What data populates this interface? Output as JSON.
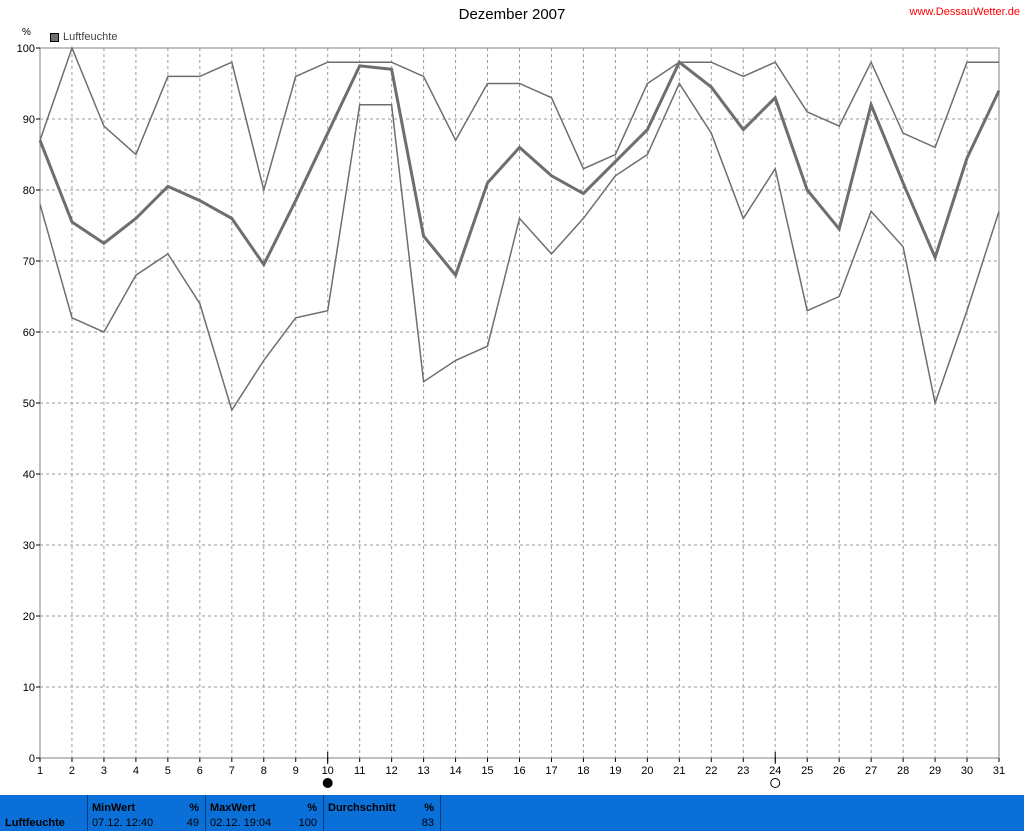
{
  "header": {
    "title": "Dezember 2007",
    "site": "www.DessauWetter.de"
  },
  "legend": {
    "label": "Luftfeuchte",
    "color": "#6e6e6e"
  },
  "chart_data": {
    "type": "line",
    "title": "Dezember 2007",
    "ylabel": "%",
    "xlabel": "",
    "ylim": [
      0,
      100
    ],
    "yticks": [
      0,
      10,
      20,
      30,
      40,
      50,
      60,
      70,
      80,
      90,
      100
    ],
    "xlim": [
      1,
      31
    ],
    "x": [
      1,
      2,
      3,
      4,
      5,
      6,
      7,
      8,
      9,
      10,
      11,
      12,
      13,
      14,
      15,
      16,
      17,
      18,
      19,
      20,
      21,
      22,
      23,
      24,
      25,
      26,
      27,
      28,
      29,
      30,
      31
    ],
    "series": [
      {
        "name": "max",
        "values": [
          87,
          100,
          89,
          85,
          96,
          96,
          98,
          80,
          96,
          98,
          98,
          98,
          96,
          87,
          95,
          95,
          93,
          83,
          85,
          95,
          98,
          98,
          96,
          98,
          91,
          89,
          98,
          88,
          86,
          98,
          98
        ]
      },
      {
        "name": "avg",
        "values": [
          87,
          75.5,
          72.5,
          76,
          80.5,
          78.5,
          76,
          69.5,
          78.5,
          88,
          97.5,
          97,
          73.5,
          68,
          81,
          86,
          82,
          79.5,
          84,
          88.5,
          98,
          94.5,
          88.5,
          93,
          80,
          74.5,
          92,
          81,
          70.5,
          84.5,
          94
        ]
      },
      {
        "name": "min",
        "values": [
          78,
          62,
          60,
          68,
          71,
          64,
          49,
          56,
          62,
          63,
          92,
          92,
          53,
          56,
          58,
          76,
          71,
          76,
          82,
          85,
          95,
          88,
          76,
          83,
          63,
          65,
          77,
          72,
          50,
          63,
          77
        ]
      }
    ],
    "markers": [
      {
        "x": 10,
        "kind": "filled"
      },
      {
        "x": 24,
        "kind": "open"
      }
    ],
    "grid": true,
    "legend_position": "top-left"
  },
  "footer": {
    "row_label": "Luftfeuchte",
    "min": {
      "header": "MinWert",
      "unit": "%",
      "date": "07.12.  12:40",
      "value": "49"
    },
    "max": {
      "header": "MaxWert",
      "unit": "%",
      "date": "02.12.  19:04",
      "value": "100"
    },
    "avg": {
      "header": "Durchschnitt",
      "unit": "%",
      "value": "83"
    }
  }
}
